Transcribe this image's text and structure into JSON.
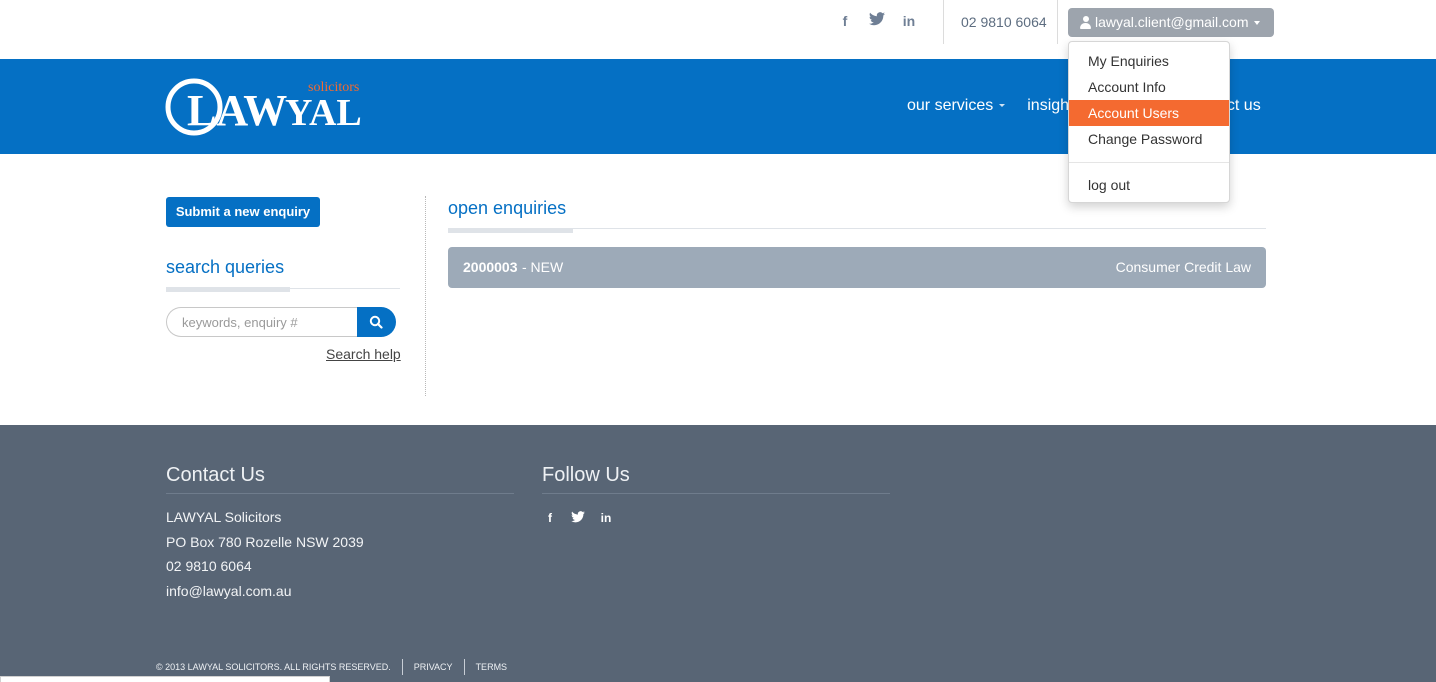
{
  "topbar": {
    "social": {
      "facebook": "f",
      "twitter": "t",
      "linkedin": "in"
    },
    "phone": "02 9810 6064",
    "user_email": "lawyal.client@gmail.com"
  },
  "header": {
    "logo_text": "LAWYAL",
    "logo_sub": "solicitors",
    "nav": {
      "services": "our services",
      "insights": "insigh",
      "contact": "act us"
    }
  },
  "dropdown": {
    "items": [
      "My Enquiries",
      "Account Info",
      "Account Users",
      "Change Password"
    ],
    "logout": "log out",
    "active_index": 2
  },
  "sidebar": {
    "submit_label": "Submit a new enquiry",
    "search_title": "search queries",
    "search_placeholder": "keywords, enquiry #",
    "search_help": "Search help"
  },
  "main": {
    "title": "open enquiries",
    "enquiries": [
      {
        "id": "2000003",
        "status": "- NEW",
        "area": "Consumer Credit Law"
      }
    ]
  },
  "footer": {
    "contact_title": "Contact Us",
    "follow_title": "Follow Us",
    "company": "LAWYAL Solicitors",
    "address": "PO Box 780 Rozelle NSW 2039",
    "phone": "02 9810 6064",
    "email": "info@lawyal.com.au",
    "copyright": "© 2013 LAWYAL SOLICITORS. ALL RIGHTS RESERVED.",
    "privacy": "PRIVACY",
    "terms": "TERMS"
  },
  "colors": {
    "brand_blue": "#0570c4",
    "accent_orange": "#f46a30",
    "footer_bg": "#586575",
    "row_bg": "#9daab8"
  }
}
